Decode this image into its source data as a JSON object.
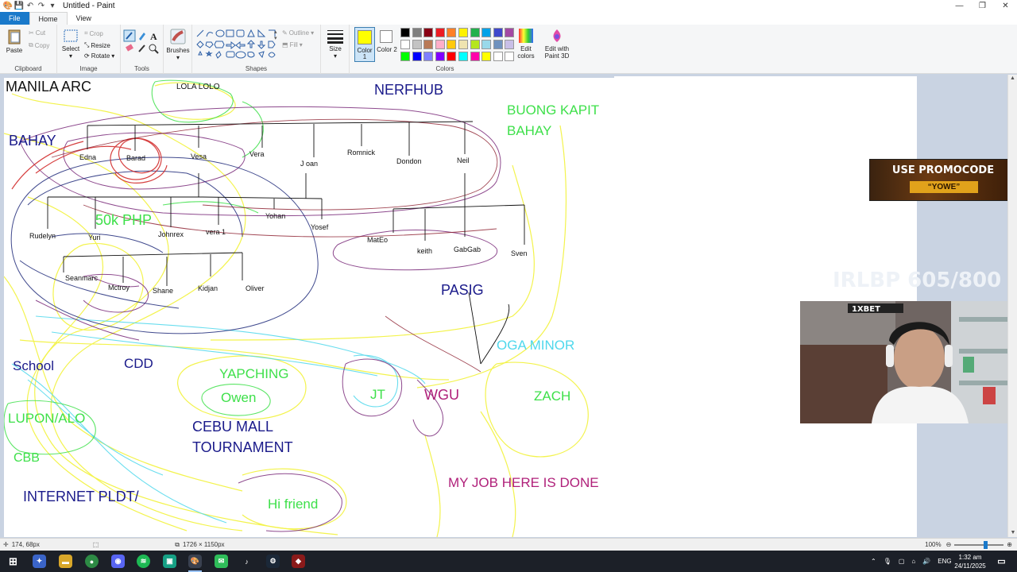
{
  "window": {
    "title": "Untitled - Paint",
    "minimize": "—",
    "maximize": "❐",
    "close": "✕"
  },
  "ribbon": {
    "tabs": [
      "File",
      "Home",
      "View"
    ],
    "clipboard": {
      "label": "Clipboard",
      "paste": "Paste",
      "cut": "Cut",
      "copy": "Copy"
    },
    "image": {
      "label": "Image",
      "select": "Select",
      "crop": "Crop",
      "resize": "Resize",
      "rotate": "Rotate"
    },
    "tools": {
      "label": "Tools"
    },
    "brushes": {
      "label": "Brushes"
    },
    "shapes": {
      "label": "Shapes",
      "outline": "Outline",
      "fill": "Fill"
    },
    "size": {
      "label": "Size"
    },
    "colors": {
      "label": "Colors",
      "color1": "Color 1",
      "color2": "Color 2",
      "edit_colors": "Edit colors",
      "edit_paint3d": "Edit with Paint 3D",
      "color1_value": "#ffff00",
      "color2_value": "#ffffff",
      "palette_row1": [
        "#000000",
        "#7f7f7f",
        "#880015",
        "#ed1c24",
        "#ff7f27",
        "#fff200",
        "#22b14c",
        "#00a2e8",
        "#3f48cc",
        "#a349a4"
      ],
      "palette_row2": [
        "#ffffff",
        "#c3c3c3",
        "#b97a57",
        "#ffaec9",
        "#ffc90e",
        "#efe4b0",
        "#b5e61d",
        "#99d9ea",
        "#7092be",
        "#c8bfe7"
      ],
      "palette_row3": [
        "#00ff00",
        "#0000ff",
        "#8080ff",
        "#8000ff",
        "#ff0000",
        "#00ffff",
        "#ff00aa",
        "#ffff00",
        "#ffffff",
        "#ffffff"
      ]
    }
  },
  "canvas": {
    "labels": {
      "manila_arc": "MANILA ARC",
      "lola_lolo": "LOLA LOLO",
      "nerfhub": "NERFHUB",
      "buong_kapit_1": "BUONG KAPIT",
      "buong_kapit_2": "BAHAY",
      "bahay": "BAHAY",
      "php": "50k PHP",
      "pasig": "PASIG",
      "oga_minor": "OGA MINOR",
      "school": "School",
      "cdd": "CDD",
      "yapching": "YAPCHING",
      "owen": "Owen",
      "jt": "JT",
      "wgu": "WGU",
      "zach": "ZACH",
      "lupon": "LUPON/ALO",
      "cebu_1": "CEBU MALL",
      "cebu_2": "TOURNAMENT",
      "cbb": "CBB",
      "internet": "INTERNET PLDT/",
      "hi_friend": "Hi friend",
      "my_job": "MY JOB HERE IS DONE"
    },
    "names": [
      "Edna",
      "Barad",
      "Vesa",
      "Vera",
      "J oan",
      "Romnick",
      "Dondon",
      "Neil",
      "Rudelyn",
      "Yuri",
      "Johnrex",
      "vera 1",
      "Yohan",
      "Yosef",
      "MatEo",
      "keith",
      "GabGab",
      "Sven",
      "Seanmarc",
      "Mctroy",
      "Shane",
      "Kidjan",
      "Oliver"
    ]
  },
  "overlays": {
    "promo_line1": "USE PROMOCODE",
    "promo_line2": "“YOWE”",
    "counter": "IRLBP 605/800",
    "sponsor": "1XBET"
  },
  "status": {
    "cursor_pos": "174, 68px",
    "canvas_size": "1726 × 1150px",
    "zoom": "100%"
  },
  "taskbar": {
    "lang": "ENG",
    "time": "1:32 am",
    "date": "24/11/2025"
  }
}
